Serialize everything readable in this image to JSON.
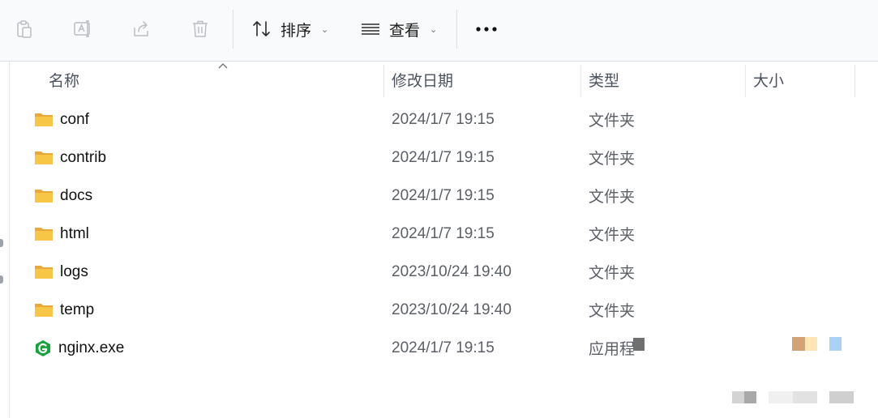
{
  "toolbar": {
    "sort_label": "排序",
    "view_label": "查看",
    "more_label": "•••",
    "icons": [
      "paste-icon",
      "rename-icon",
      "share-icon",
      "delete-icon",
      "sort-icon",
      "view-icon",
      "chevron-down-icon",
      "more-icon"
    ]
  },
  "columns": {
    "name": "名称",
    "modified": "修改日期",
    "type": "类型",
    "size": "大小"
  },
  "files": [
    {
      "name": "conf",
      "modified": "2024/1/7 19:15",
      "type": "文件夹",
      "icon": "folder-icon"
    },
    {
      "name": "contrib",
      "modified": "2024/1/7 19:15",
      "type": "文件夹",
      "icon": "folder-icon"
    },
    {
      "name": "docs",
      "modified": "2024/1/7 19:15",
      "type": "文件夹",
      "icon": "folder-icon"
    },
    {
      "name": "html",
      "modified": "2024/1/7 19:15",
      "type": "文件夹",
      "icon": "folder-icon"
    },
    {
      "name": "logs",
      "modified": "2023/10/24 19:40",
      "type": "文件夹",
      "icon": "folder-icon"
    },
    {
      "name": "temp",
      "modified": "2023/10/24 19:40",
      "type": "文件夹",
      "icon": "folder-icon"
    },
    {
      "name": "nginx.exe",
      "modified": "2024/1/7 19:15",
      "type": "应用程",
      "icon": "nginx-exe-icon"
    }
  ],
  "colors": {
    "folder": "#f7c646",
    "folder_dark": "#e8a93a",
    "nginx_green": "#16a33a",
    "toolbar_bg": "#f9fafb"
  }
}
